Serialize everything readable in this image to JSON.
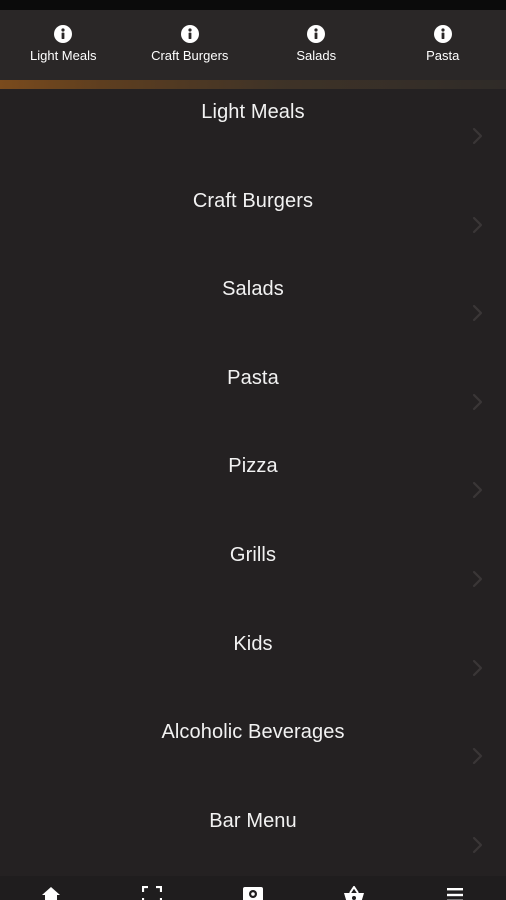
{
  "top_tabs": [
    {
      "label": "Light Meals",
      "icon": "info-icon"
    },
    {
      "label": "Craft Burgers",
      "icon": "info-icon"
    },
    {
      "label": "Salads",
      "icon": "info-icon"
    },
    {
      "label": "Pasta",
      "icon": "info-icon"
    }
  ],
  "menu": {
    "items": [
      {
        "label": "Light Meals"
      },
      {
        "label": "Craft Burgers"
      },
      {
        "label": "Salads"
      },
      {
        "label": "Pasta"
      },
      {
        "label": "Pizza"
      },
      {
        "label": "Grills"
      },
      {
        "label": "Kids"
      },
      {
        "label": "Alcoholic Beverages"
      },
      {
        "label": "Bar Menu"
      }
    ]
  },
  "bottom_nav": [
    {
      "icon": "home-icon"
    },
    {
      "icon": "scan-icon"
    },
    {
      "icon": "menu-card-icon"
    },
    {
      "icon": "basket-icon"
    },
    {
      "icon": "hamburger-menu-icon"
    }
  ],
  "colors": {
    "background": "#242122",
    "tab_bar": "#2a2727",
    "accent": "#7a4b1d",
    "text": "#ffffff",
    "chevron": "#3a3637"
  }
}
